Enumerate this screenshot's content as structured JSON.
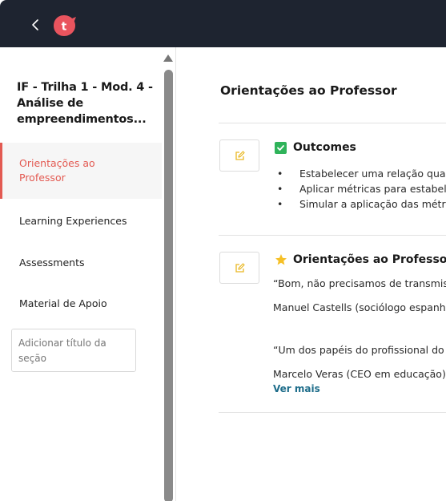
{
  "colors": {
    "topbar": "#1e2430",
    "accent": "#e35a52",
    "check": "#2fb35a",
    "star": "#f6c026",
    "link": "#1e6d8a",
    "edit_icon": "#e9b824"
  },
  "topbar": {
    "back_icon": "chevron-left-icon",
    "logo_letter": "t"
  },
  "sidebar": {
    "course_title": "IF - Trilha 1 - Mod. 4 - Análise de empreendimentos...",
    "items": [
      {
        "label": "Orientações ao Professor",
        "active": true
      },
      {
        "label": "Learning Experiences",
        "active": false
      },
      {
        "label": "Assessments",
        "active": false
      },
      {
        "label": "Material de Apoio",
        "active": false
      }
    ],
    "add_section_placeholder": "Adicionar título da seção"
  },
  "main": {
    "page_title": "Orientações ao Professor",
    "outcomes": {
      "icon": "checkbox-checked-icon",
      "heading": "Outcomes",
      "bullets": [
        "Estabelecer uma relação quan",
        "Aplicar métricas para estabele",
        "Simular a aplicação das métric"
      ]
    },
    "orientations": {
      "icon": "star-icon",
      "heading": "Orientações ao Professor",
      "quote1": "“Bom, não precisamos de transmiss",
      "author1": "Manuel Castells (sociólogo espanho",
      "quote2": "“Um dos papéis do profissional do f",
      "author2": "Marcelo Veras (CEO em educação)",
      "see_more": "Ver mais"
    }
  }
}
